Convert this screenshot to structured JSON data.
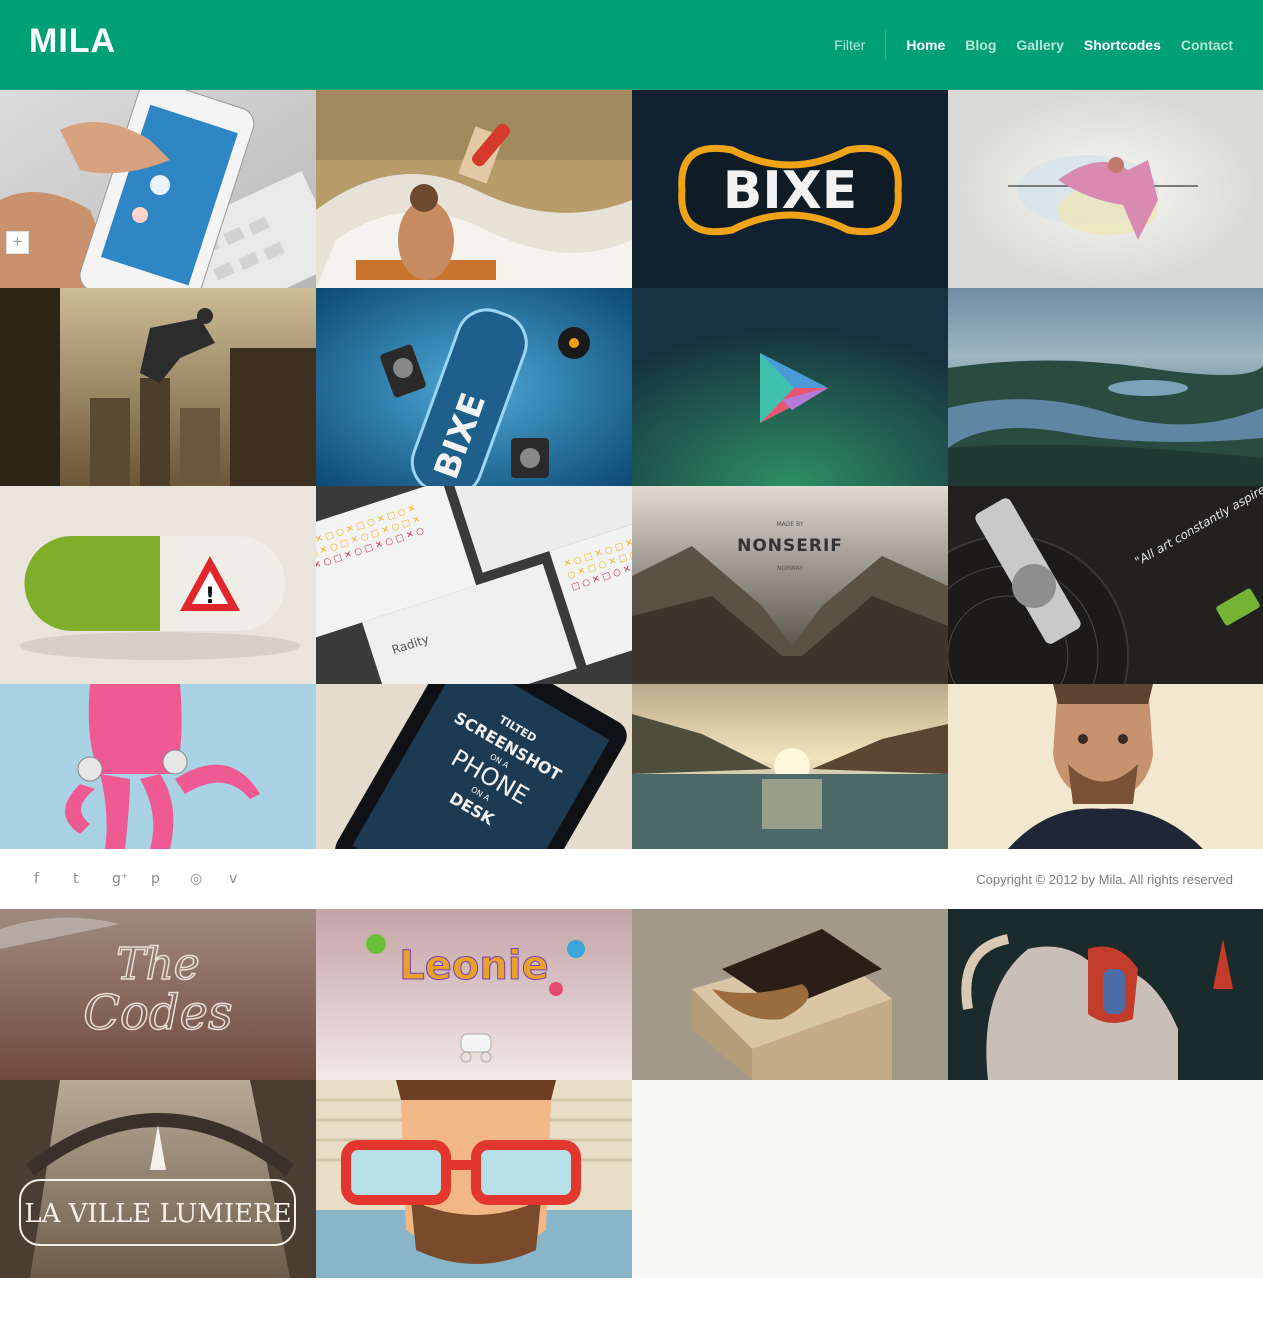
{
  "header": {
    "logo": "MILA",
    "filter_label": "Filter",
    "nav": [
      {
        "label": "Home",
        "state": "active"
      },
      {
        "label": "Blog",
        "state": "muted"
      },
      {
        "label": "Gallery",
        "state": "muted"
      },
      {
        "label": "Shortcodes",
        "state": "active"
      },
      {
        "label": "Contact",
        "state": "muted"
      }
    ],
    "colors": {
      "bar": "#00a076",
      "active_link": "#ffffff",
      "muted_link": "#b4e6d6"
    }
  },
  "tile_overlay": {
    "expand_symbol": "+"
  },
  "tiles": {
    "bixe_logo_text": "BIXE",
    "bixe_bottle_text": "BIXE",
    "nonserif_made_by": "MADE BY",
    "nonserif_title": "NONSERIF",
    "nonserif_country": "NORWAY",
    "screenshot_line1": "TILTED",
    "screenshot_line2": "SCREENSHOT",
    "screenshot_line3": "ON A",
    "screenshot_line4": "PHONE",
    "screenshot_line5": "ON A",
    "screenshot_line6": "DESK",
    "radity_text": "Radity",
    "codes_line1": "The",
    "codes_line2": "Codes",
    "leonie_text": "Leonie",
    "lumiere_text": "LA VILLE LUMIERE",
    "record_quote": "\"All art constantly aspires towards the condition of music\""
  },
  "footer": {
    "social_icons": [
      {
        "name": "facebook-icon",
        "glyph": "f"
      },
      {
        "name": "twitter-icon",
        "glyph": "t"
      },
      {
        "name": "google-plus-icon",
        "glyph": "g⁺"
      },
      {
        "name": "pinterest-icon",
        "glyph": "p"
      },
      {
        "name": "dribbble-icon",
        "glyph": "◎"
      },
      {
        "name": "vimeo-icon",
        "glyph": "v"
      }
    ],
    "copyright": "Copyright © 2012 by Mila. All rights reserved"
  }
}
